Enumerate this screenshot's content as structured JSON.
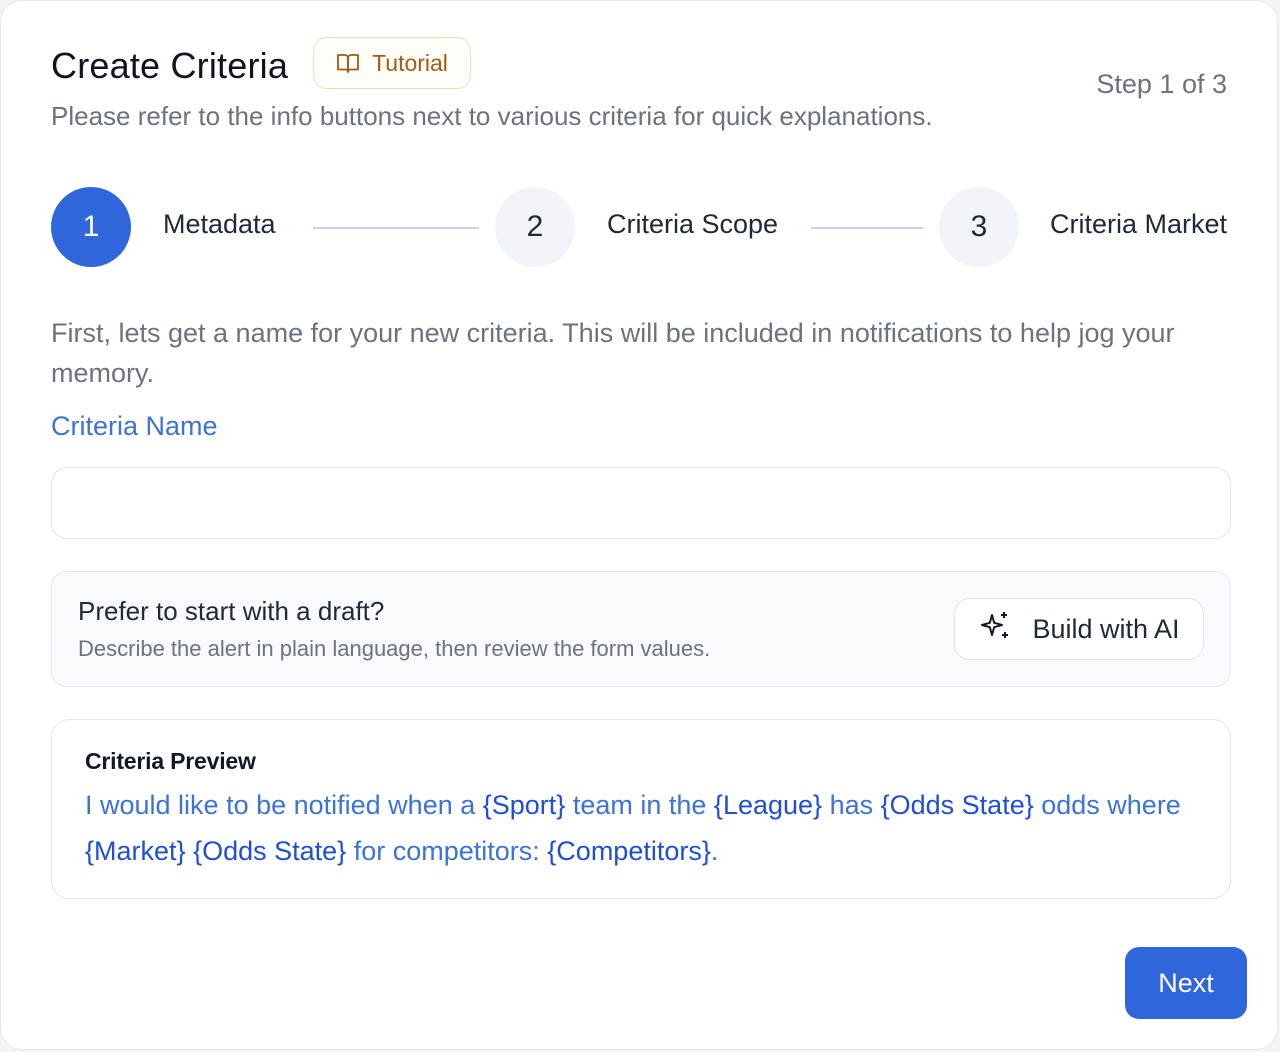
{
  "header": {
    "title": "Create Criteria",
    "tutorial_label": "Tutorial",
    "tutorial_icon": "book-open-icon",
    "step_count": "Step 1 of 3",
    "subtitle": "Please refer to the info buttons next to various criteria for quick explanations."
  },
  "stepper": {
    "steps": [
      {
        "number": "1",
        "label": "Metadata",
        "state": "active"
      },
      {
        "number": "2",
        "label": "Criteria Scope",
        "state": "inactive"
      },
      {
        "number": "3",
        "label": "Criteria Market",
        "state": "inactive"
      }
    ]
  },
  "form": {
    "intro": "First, lets get a name for your new criteria. This will be included in notifications to help jog your memory.",
    "name_label": "Criteria Name",
    "name_value": "",
    "name_placeholder": ""
  },
  "draft": {
    "title": "Prefer to start with a draft?",
    "description": "Describe the alert in plain language, then review the form values.",
    "button_label": "Build with AI",
    "button_icon": "sparkles-icon"
  },
  "preview": {
    "title": "Criteria Preview",
    "segments": [
      {
        "text": "I would like to be notified when a ",
        "token": false
      },
      {
        "text": "{Sport}",
        "token": true
      },
      {
        "text": " team in the ",
        "token": false
      },
      {
        "text": "{League}",
        "token": true
      },
      {
        "text": " has ",
        "token": false
      },
      {
        "text": "{Odds State}",
        "token": true
      },
      {
        "text": " odds where ",
        "token": false
      },
      {
        "text": "{Market}",
        "token": true
      },
      {
        "text": " ",
        "token": false
      },
      {
        "text": "{Odds State}",
        "token": true
      },
      {
        "text": " for competitors: ",
        "token": false
      },
      {
        "text": "{Competitors}",
        "token": true
      },
      {
        "text": ".",
        "token": false
      }
    ]
  },
  "footer": {
    "next_label": "Next"
  },
  "colors": {
    "accent": "#2f66db",
    "label_blue": "#3b73d8",
    "token_blue": "#1e4fd6",
    "tutorial_text": "#a35a12",
    "tutorial_border": "#f4d9a8"
  }
}
